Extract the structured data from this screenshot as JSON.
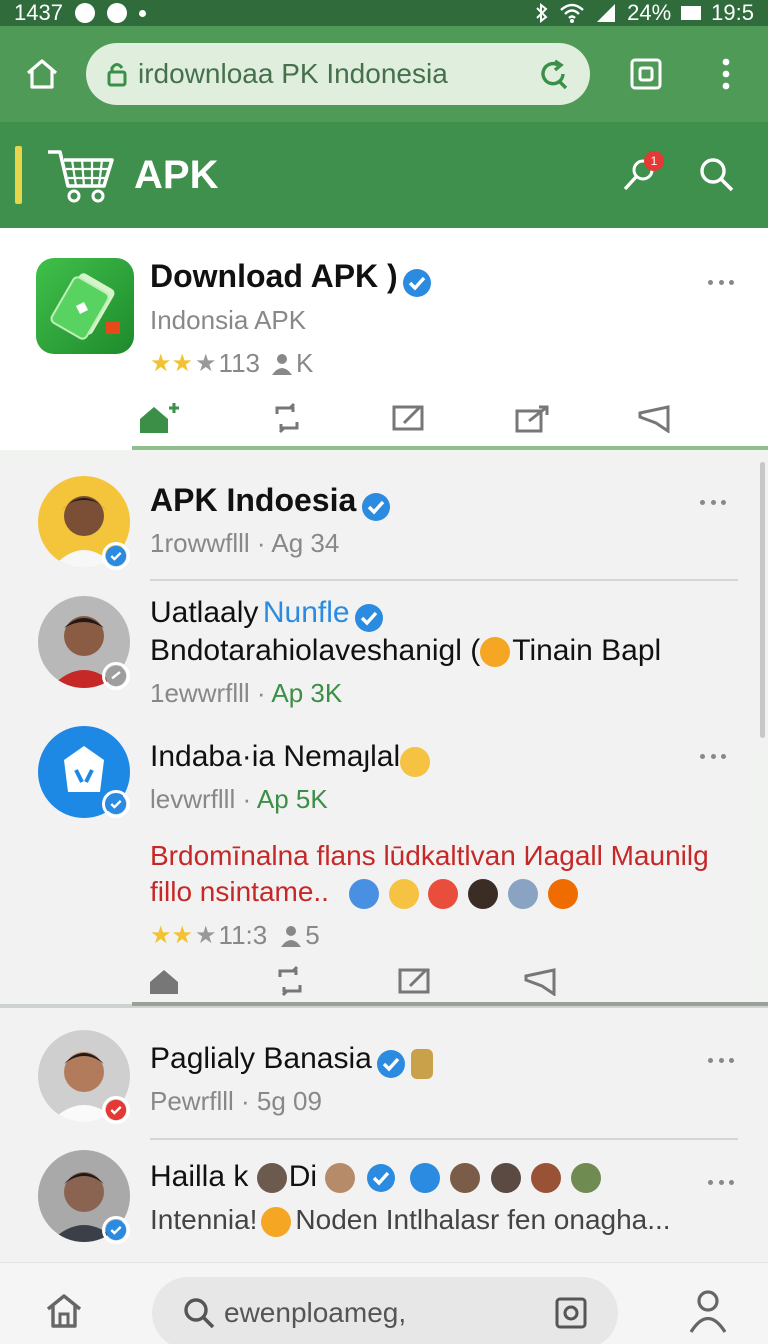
{
  "status_bar": {
    "time_left": "1437",
    "battery": "24%",
    "time_right": "19:5"
  },
  "browser": {
    "url_text": "irdownloaa PK Indonesia",
    "icons": [
      "home-icon",
      "lock-icon",
      "reload-icon",
      "tab-icon",
      "menu-icon"
    ]
  },
  "site_header": {
    "logo_text": "APK",
    "icons": [
      "cart-logo-icon",
      "notification-icon",
      "search-icon"
    ],
    "notification_count": "1"
  },
  "app_card": {
    "title": "Download APK )",
    "subtitle": "Indonsia APK",
    "rating_stars": 3,
    "meta": "113",
    "meta_suffix": "K"
  },
  "feed": {
    "post1": {
      "name": "APK Indoesia",
      "meta": "1rowwflll · Ag 34"
    },
    "post2": {
      "name": "Uatlaaly",
      "name_link": "Nunfle",
      "text": "Bndotarahiolaveshanigl (",
      "text_tail": "Tinain Bapl",
      "meta_a": "1ewwrflll · ",
      "meta_b": "Ap 3K"
    },
    "post3": {
      "name": "Indaba·ia Nemaȷlal",
      "meta_a": "levwrflll · ",
      "meta_b": "Ap 5K",
      "body_line1": "Brdomīnalna flans lūdkaltlvan Иagall Maunilg",
      "body_line2": "fillo nsintame..",
      "rating_stars": 3,
      "stat_a": "11:3",
      "stat_b": "5"
    },
    "post4": {
      "name": "Paglialy Banasia",
      "meta": "Pewrflll · 5g 09"
    },
    "post5": {
      "name": "Hailla k",
      "name_mid": "Di",
      "text_a": "Intennia!",
      "text_b": "Noden Intlhalasr fen onagha..."
    }
  },
  "bottom_bar": {
    "search_text": "ewenploameg,"
  },
  "colors": {
    "header_green": "#3f8f4d",
    "browser_green": "#4f9a57",
    "verified_blue": "#2b8be0",
    "red_text": "#c62828",
    "star": "#f2c230"
  }
}
